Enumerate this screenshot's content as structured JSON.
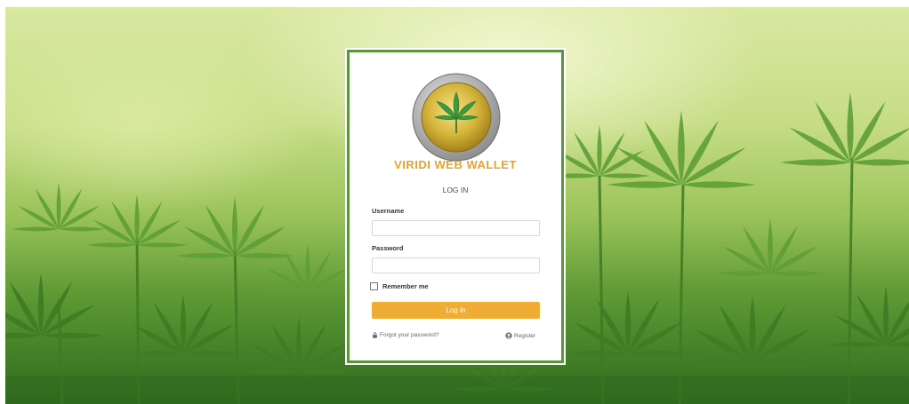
{
  "login": {
    "brand_name": "VIRIDI WEB WALLET",
    "heading": "LOG IN",
    "username_label": "Username",
    "username_value": "",
    "password_label": "Password",
    "password_value": "",
    "remember_label": "Remember me",
    "login_button": "Log In",
    "forgot_link": "Forgot your password?",
    "register_link": "Register"
  },
  "icons": {
    "logo": "viridi-coin-logo",
    "forgot": "lock-icon",
    "register": "user-circle-icon"
  },
  "colors": {
    "brand": "#e8a32a",
    "button": "#f0ad36",
    "card_border": "#5d9441"
  }
}
